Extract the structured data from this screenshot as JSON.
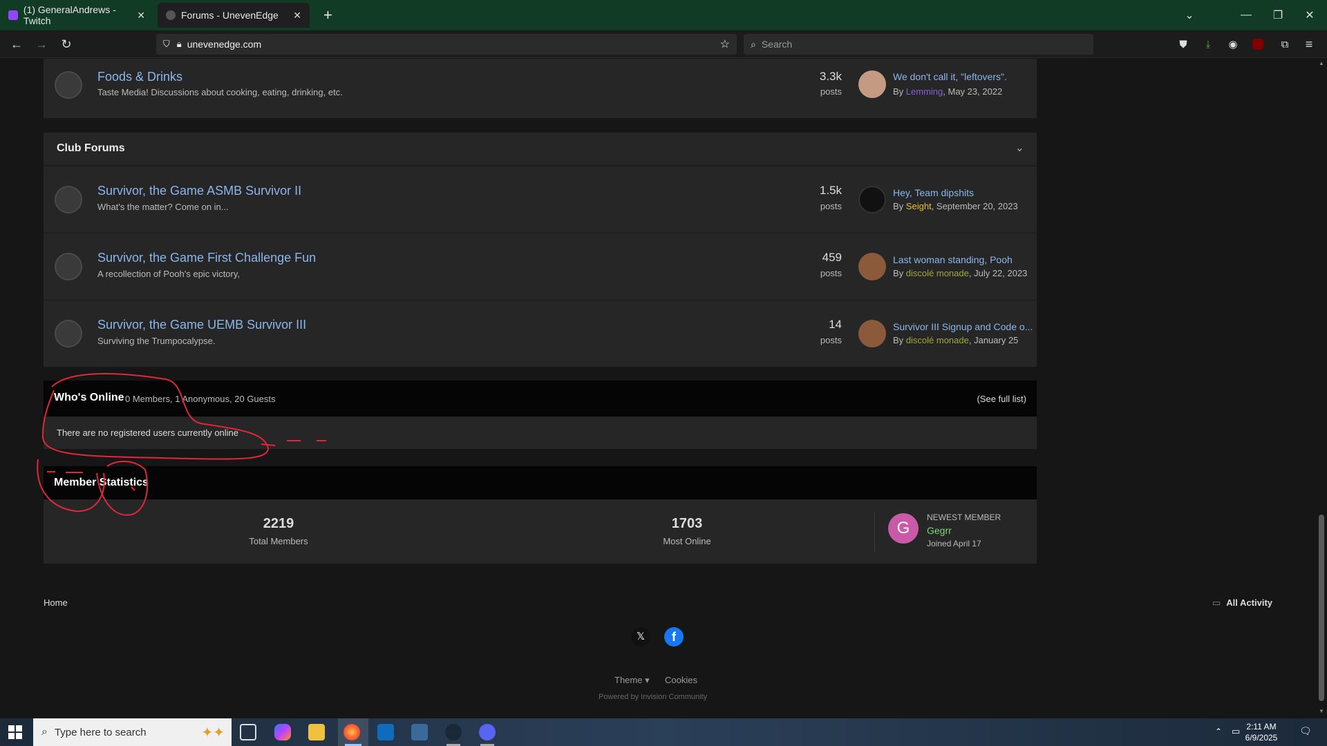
{
  "browser": {
    "tabs": [
      {
        "title": "(1) GeneralAndrews - Twitch"
      },
      {
        "title": "Forums - UnevenEdge"
      }
    ],
    "url": "unevenedge.com",
    "search_placeholder": "Search"
  },
  "forums": {
    "top_row": {
      "title": "Foods & Drinks",
      "desc": "Taste Media! Discussions about cooking, eating, drinking, etc.",
      "count": "3.3k",
      "count_label": "posts",
      "last_title": "We don't call it, \"leftovers\".",
      "last_by_prefix": "By",
      "last_author": "Lemming",
      "last_date": ", May 23, 2022"
    },
    "club_header": "Club Forums",
    "club_rows": [
      {
        "title": "Survivor, the Game ASMB Survivor II",
        "desc": "What's the matter?  Come on in...",
        "count": "1.5k",
        "count_label": "posts",
        "last_title": "Hey, Team dipshits",
        "last_by_prefix": "By",
        "last_author": "Seight",
        "last_date": ", September 20, 2023"
      },
      {
        "title": "Survivor, the Game First Challenge Fun",
        "desc": "A recollection of Pooh's epic victory,",
        "count": "459",
        "count_label": "posts",
        "last_title": "Last woman standing, Pooh",
        "last_by_prefix": "By",
        "last_author": "discolé monade",
        "last_date": ", July 22, 2023"
      },
      {
        "title": "Survivor, the Game UEMB Survivor III",
        "desc": "Surviving the Trumpocalypse.",
        "count": "14",
        "count_label": "posts",
        "last_title": "Survivor III Signup and Code o...",
        "last_by_prefix": "By",
        "last_author": "discolé monade",
        "last_date": ", January 25"
      }
    ]
  },
  "whos_online": {
    "title": "Who's Online",
    "summary": "0 Members, 1 Anonymous, 20 Guests",
    "see_full": "(See full list)",
    "body": "There are no registered users currently online"
  },
  "member_stats": {
    "title": "Member Statistics",
    "total_members": "2219",
    "total_members_label": "Total Members",
    "most_online": "1703",
    "most_online_label": "Most Online",
    "newest_label": "NEWEST MEMBER",
    "newest_initial": "G",
    "newest_name": "Gegrr",
    "newest_joined": "Joined April 17"
  },
  "footer": {
    "home": "Home",
    "all_activity": "All Activity",
    "theme": "Theme ▾",
    "cookies": "Cookies",
    "powered": "Powered by Invision Community"
  },
  "taskbar": {
    "search_placeholder": "Type here to search",
    "time": "2:11 AM",
    "date": "6/9/2025"
  },
  "colors": {
    "accent_link": "#8ab6ec",
    "author_lemming": "#8a5fd6",
    "author_seight": "#e8c030",
    "author_discole": "#9fa83a",
    "newest_member": "#7ed67e",
    "annotation_red": "#e0283a"
  }
}
